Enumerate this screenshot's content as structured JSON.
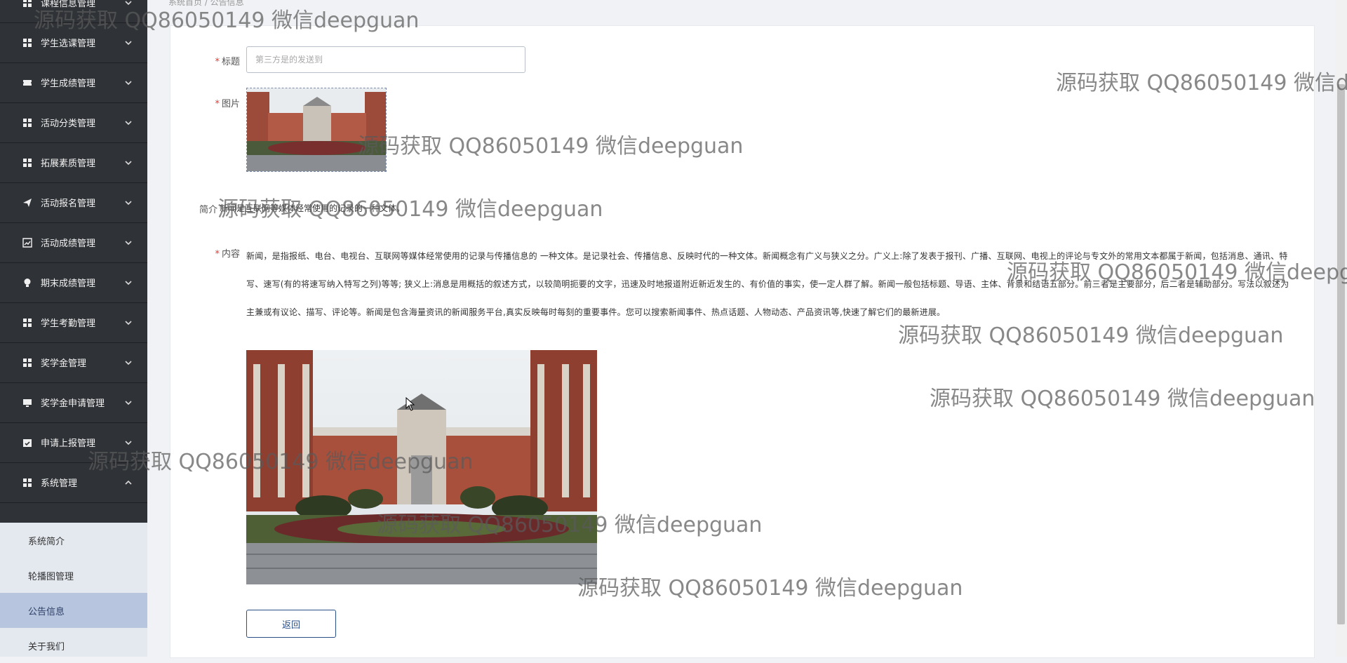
{
  "sidebar": {
    "items": [
      {
        "label": "课程信息管理",
        "icon": "grid-icon"
      },
      {
        "label": "学生选课管理",
        "icon": "grid-icon"
      },
      {
        "label": "学生成绩管理",
        "icon": "ticket-icon"
      },
      {
        "label": "活动分类管理",
        "icon": "grid-icon"
      },
      {
        "label": "拓展素质管理",
        "icon": "grid-icon"
      },
      {
        "label": "活动报名管理",
        "icon": "send-icon"
      },
      {
        "label": "活动成绩管理",
        "icon": "chart-icon"
      },
      {
        "label": "期末成绩管理",
        "icon": "bulb-icon"
      },
      {
        "label": "学生考勤管理",
        "icon": "grid-icon"
      },
      {
        "label": "奖学金管理",
        "icon": "grid-icon"
      },
      {
        "label": "奖学金申请管理",
        "icon": "monitor-icon"
      },
      {
        "label": "申请上报管理",
        "icon": "calendar-check-icon"
      },
      {
        "label": "系统管理",
        "icon": "grid-icon"
      }
    ],
    "submenu": [
      {
        "label": "系统简介"
      },
      {
        "label": "轮播图管理"
      },
      {
        "label": "公告信息",
        "active": true
      },
      {
        "label": "关于我们"
      }
    ]
  },
  "breadcrumb": {
    "text": "系统首页 / 公告信息"
  },
  "form": {
    "title_label": "标题",
    "title_placeholder": "第三方是的发送到",
    "image_label": "图片",
    "intro_label": "简介",
    "intro_text": "新闻是互联网等媒体经常使用的记录的一种文体。",
    "content_label": "内容",
    "content_text": "新闻，是指报纸、电台、电视台、互联网等媒体经常使用的记录与传播信息的 一种文体。是记录社会、传播信息、反映时代的一种文体。新闻概念有广义与狭义之分。广义上:除了发表于报刊、广播、互联网、电视上的评论与专文外的常用文本都属于新闻，包括消息、通讯、特写、速写(有的将速写纳入特写之列)等等; 狭义上:消息是用概括的叙述方式，以较简明扼要的文字，迅速及时地报道附近新近发生的、有价值的事实，使一定人群了解。新闻一般包括标题、导语、主体、背景和结语五部分。前三者是主要部分，后二者是辅助部分。写法以叙述为主兼或有议论、描写、评论等。新闻是包含海量资讯的新闻服务平台,真实反映每时每刻的重要事件。您可以搜索新闻事件、热点话题、人物动态、产品资讯等,快速了解它们的最新进展。",
    "back_label": "返回"
  },
  "watermark": "源码获取 QQ86050149 微信deepguan"
}
